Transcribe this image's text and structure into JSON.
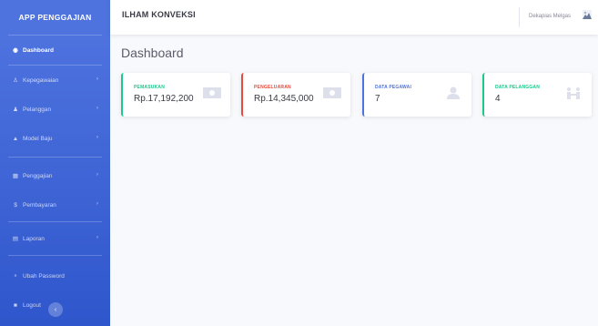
{
  "sidebar": {
    "brand": "APP PENGGAJIAN",
    "items": [
      {
        "label": "Dashboard",
        "icon": "tachometer-icon",
        "active": true
      },
      {
        "label": "Kepegawaian",
        "icon": "users-icon"
      },
      {
        "label": "Pelanggan",
        "icon": "user-group-icon"
      },
      {
        "label": "Model Baju",
        "icon": "shirt-icon"
      },
      {
        "label": "Penggajian",
        "icon": "table-icon"
      },
      {
        "label": "Pembayaran",
        "icon": "dollar-icon"
      },
      {
        "label": "Laporan",
        "icon": "file-icon"
      },
      {
        "label": "Ubah Password",
        "icon": "key-icon"
      },
      {
        "label": "Logout",
        "icon": "logout-icon"
      }
    ],
    "toggle_icon": "‹"
  },
  "topbar": {
    "title": "ILHAM KONVEKSI",
    "user_name": "Dekapias Melgas"
  },
  "page": {
    "title": "Dashboard"
  },
  "cards": [
    {
      "label": "PEMASUKAN",
      "value": "Rp.17,192,200",
      "color": "#1cc88a",
      "icon": "money-bill-icon"
    },
    {
      "label": "PENGELUARAN",
      "value": "Rp.14,345,000",
      "color": "#e74a3b",
      "icon": "money-bill-icon"
    },
    {
      "label": "DATA PEGAWAI",
      "value": "7",
      "color": "#4e73df",
      "icon": "user-icon"
    },
    {
      "label": "DATA PELANGGAN",
      "value": "4",
      "color": "#1cc88a",
      "icon": "people-icon"
    }
  ]
}
